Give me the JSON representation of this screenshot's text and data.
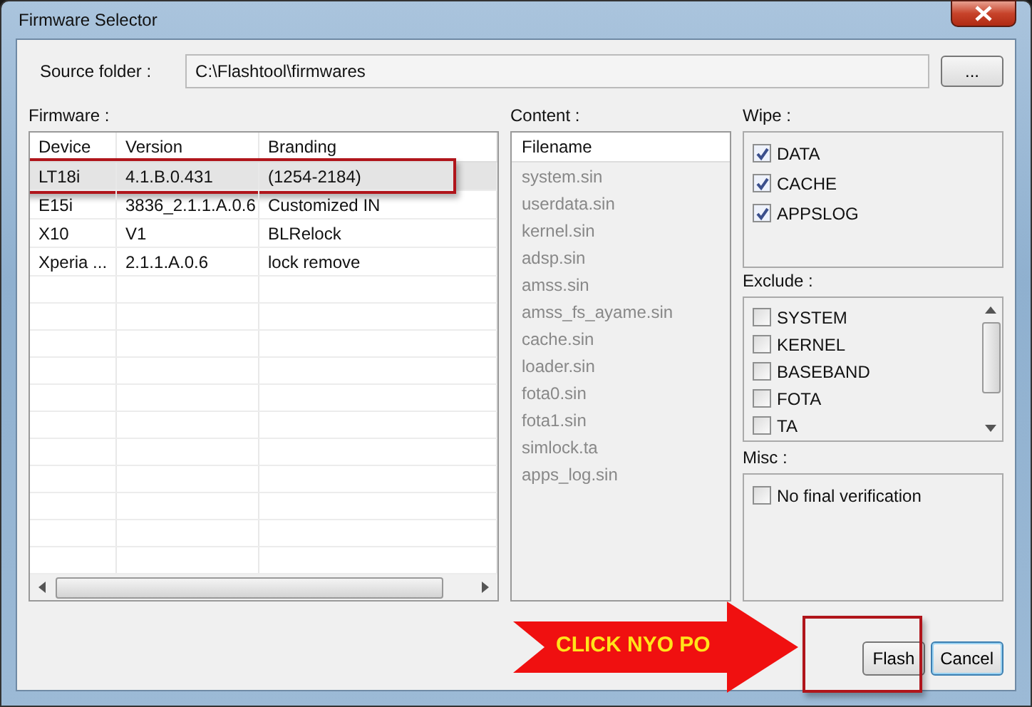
{
  "window": {
    "title": "Firmware Selector"
  },
  "source": {
    "label": "Source folder :",
    "value": "C:\\Flashtool\\firmwares",
    "browse_label": "..."
  },
  "firmware": {
    "label": "Firmware :",
    "columns": [
      "Device",
      "Version",
      "Branding"
    ],
    "rows": [
      {
        "cells": [
          "LT18i",
          "4.1.B.0.431",
          "(1254-2184)"
        ],
        "selected": true,
        "highlighted": true
      },
      {
        "cells": [
          "E15i",
          "3836_2.1.1.A.0.6",
          "Customized IN"
        ],
        "selected": false,
        "highlighted": false
      },
      {
        "cells": [
          "X10",
          "V1",
          "BLRelock"
        ],
        "selected": false,
        "highlighted": false
      },
      {
        "cells": [
          "Xperia ...",
          "2.1.1.A.0.6",
          "lock remove"
        ],
        "selected": false,
        "highlighted": false
      }
    ]
  },
  "content": {
    "label": "Content :",
    "column": "Filename",
    "files": [
      "system.sin",
      "userdata.sin",
      "kernel.sin",
      "adsp.sin",
      "amss.sin",
      "amss_fs_ayame.sin",
      "cache.sin",
      "loader.sin",
      "fota0.sin",
      "fota1.sin",
      "simlock.ta",
      "apps_log.sin"
    ]
  },
  "wipe": {
    "label": "Wipe :",
    "items": [
      {
        "label": "DATA",
        "checked": true
      },
      {
        "label": "CACHE",
        "checked": true
      },
      {
        "label": "APPSLOG",
        "checked": true
      }
    ]
  },
  "exclude": {
    "label": "Exclude :",
    "items": [
      {
        "label": "SYSTEM",
        "checked": false
      },
      {
        "label": "KERNEL",
        "checked": false
      },
      {
        "label": "BASEBAND",
        "checked": false
      },
      {
        "label": "FOTA",
        "checked": false
      },
      {
        "label": "TA",
        "checked": false
      }
    ]
  },
  "misc": {
    "label": "Misc :",
    "items": [
      {
        "label": "No final verification",
        "checked": false
      }
    ]
  },
  "buttons": [
    {
      "label": "Flash",
      "focused": false,
      "highlighted": true
    },
    {
      "label": "Cancel",
      "focused": true,
      "highlighted": false
    }
  ],
  "annotation": {
    "text": "CLICK NYO PO"
  }
}
